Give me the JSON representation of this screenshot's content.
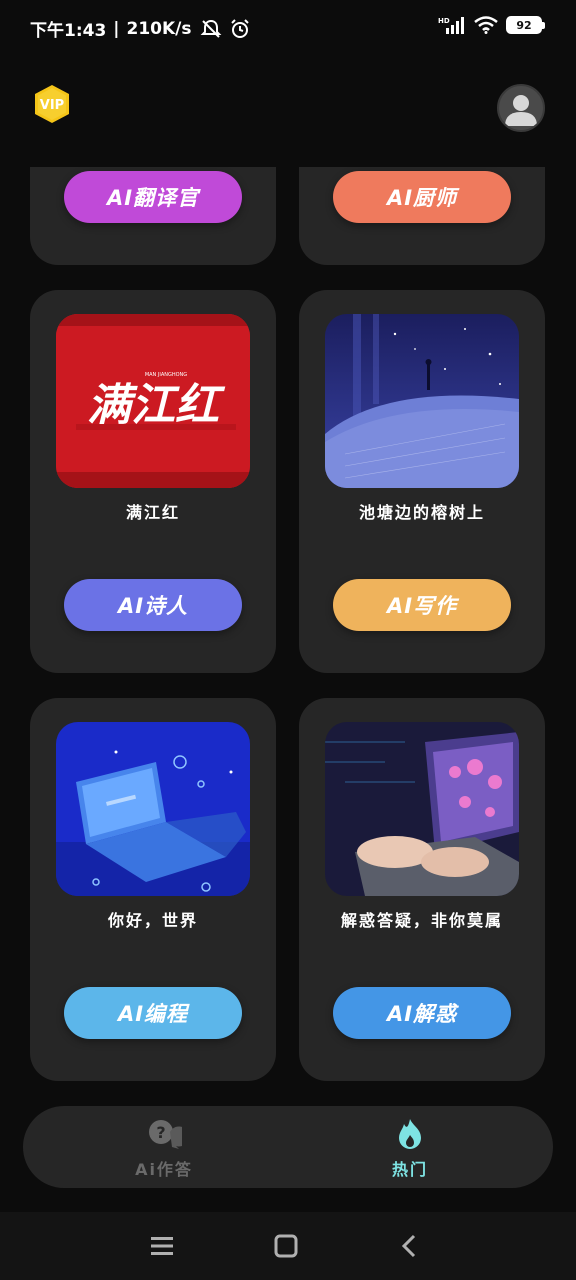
{
  "status_bar": {
    "time": "下午1:43",
    "speed": "210K/s",
    "battery": "92"
  },
  "header": {
    "vip_label": "VIP"
  },
  "cards": [
    {
      "title": "",
      "button_label": "AI翻译官",
      "button_color": "#c04ad8"
    },
    {
      "title": "",
      "button_label": "AI厨师",
      "button_color": "#ef7a5d"
    },
    {
      "title": "满江红",
      "button_label": "AI诗人",
      "button_color": "#6b72e6",
      "image_text": "满江红",
      "image_subtext": "MAN JIANGHONG"
    },
    {
      "title": "池塘边的榕树上",
      "button_label": "AI写作",
      "button_color": "#efb35c"
    },
    {
      "title": "你好，世界",
      "button_label": "AI编程",
      "button_color": "#5cb6ea"
    },
    {
      "title": "解惑答疑，非你莫属",
      "button_label": "AI解惑",
      "button_color": "#4496e6"
    }
  ],
  "bottom_nav": {
    "items": [
      {
        "label": "Ai作答",
        "icon": "chat-question-icon",
        "active": false
      },
      {
        "label": "热门",
        "icon": "flame-icon",
        "active": true
      }
    ],
    "active_color": "#7ee3e3",
    "inactive_color": "#6a6a6a"
  }
}
